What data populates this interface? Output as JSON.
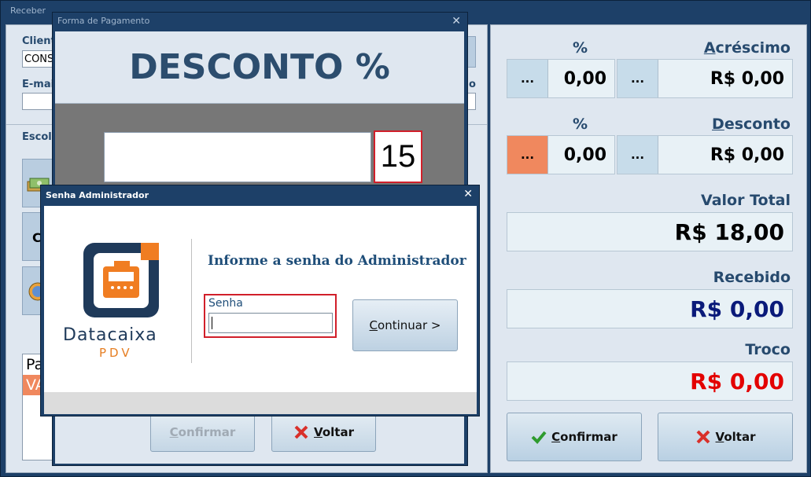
{
  "main_window": {
    "title": "Receber",
    "left": {
      "cliente_label": "Client",
      "cliente_value": "CONS",
      "email_label": "E-mai",
      "side_o_label": "o",
      "escolha_label": "Escol",
      "side_btn_2": "C",
      "list_header": "Pa",
      "list_row": "VA"
    },
    "right": {
      "pct_label_1": "%",
      "acrescimo_label_pre": "A",
      "acrescimo_label_rest": "créscimo",
      "btn_dots": "...",
      "acrescimo_pct": "0,00",
      "acrescimo_value": "R$ 0,00",
      "pct_label_2": "%",
      "desconto_label_pre": "D",
      "desconto_label_rest": "esconto",
      "desconto_pct": "0,00",
      "desconto_value": "R$ 0,00",
      "valor_total_label": "Valor Total",
      "valor_total": "R$ 18,00",
      "recebido_label": "Recebido",
      "recebido": "R$ 0,00",
      "troco_label": "Troco",
      "troco": "R$ 0,00",
      "confirmar_pre": "C",
      "confirmar_rest": "onfirmar",
      "voltar_pre": "V",
      "voltar_rest": "oltar"
    }
  },
  "payment_dialog": {
    "title": "Forma de Pagamento",
    "heading": "DESCONTO %",
    "number": "15",
    "confirmar_pre": "C",
    "confirmar_rest": "onfirmar",
    "voltar_pre": "V",
    "voltar_rest": "oltar"
  },
  "admin_dialog": {
    "title": "Senha Administrador",
    "heading": "Informe a senha do Administrador",
    "senha_label": "Senha",
    "senha_value": "",
    "continuar_pre": "C",
    "continuar_rest": "ontinuar >",
    "logo_text": "Datacaixa",
    "logo_sub": "PDV"
  },
  "colors": {
    "accent_orange": "#f0885e",
    "danger_red": "#e30000",
    "navy_value": "#0a1a7a",
    "window_blue": "#1d4068"
  }
}
